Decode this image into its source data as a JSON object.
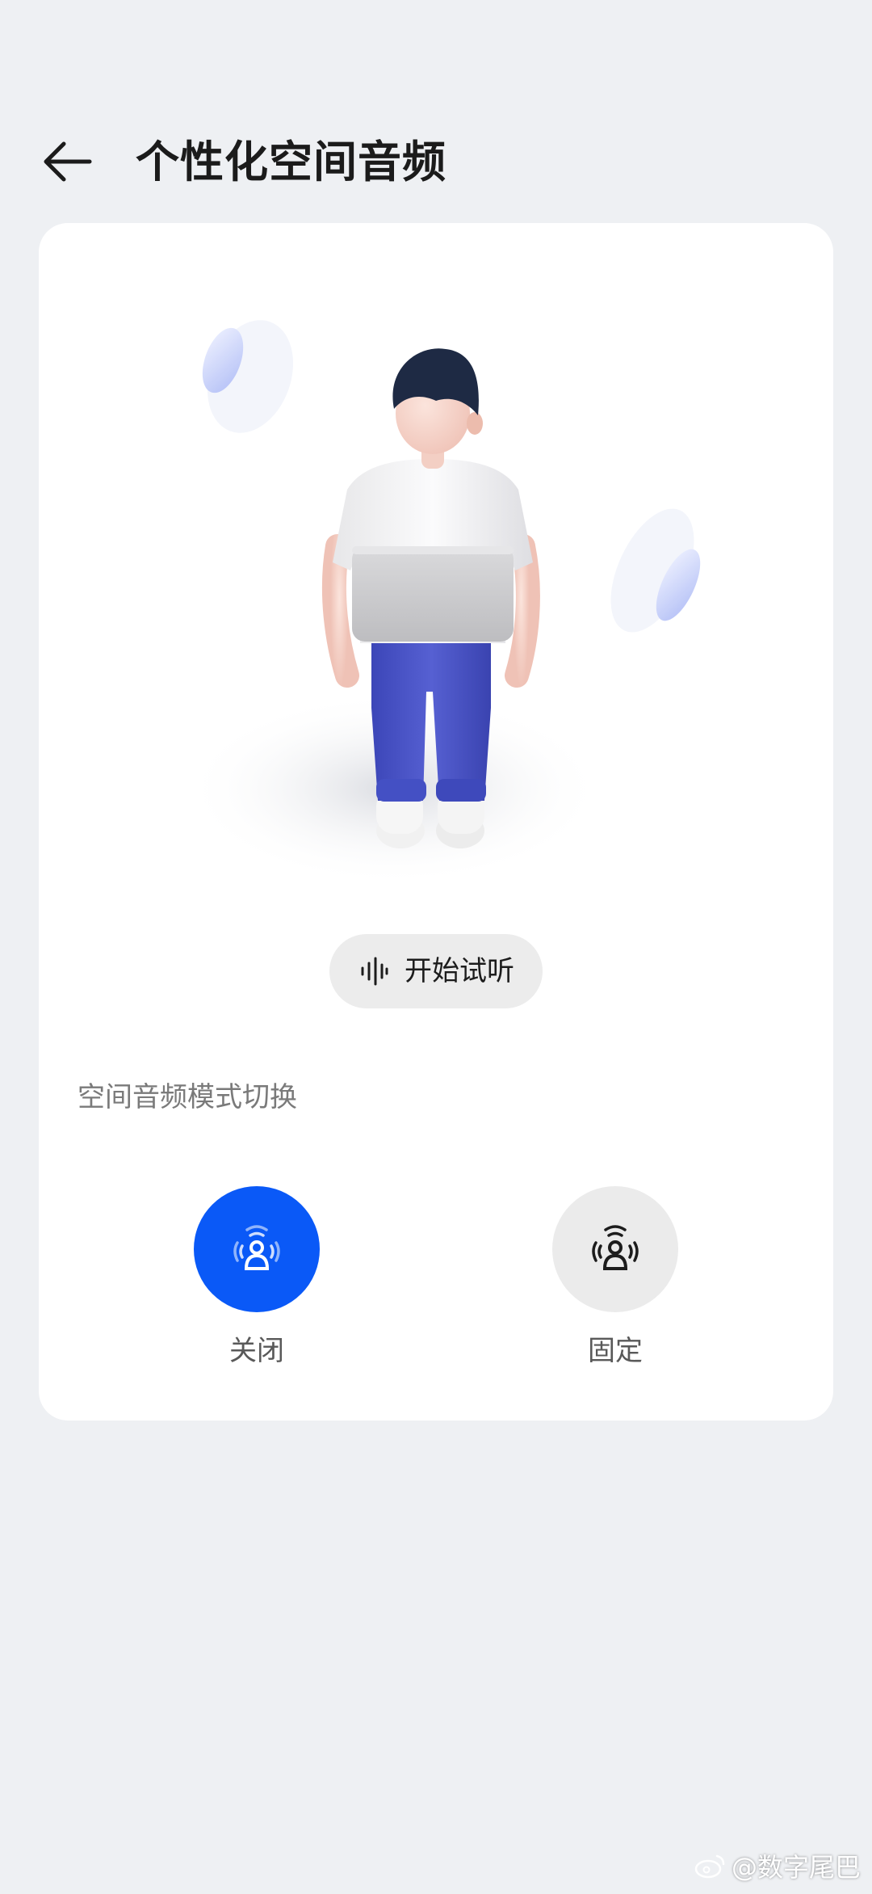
{
  "header": {
    "back_icon": "arrow-left-icon",
    "title": "个性化空间音频"
  },
  "preview": {
    "listen_icon": "sound-wave-icon",
    "listen_label": "开始试听"
  },
  "mode_section": {
    "label": "空间音频模式切换",
    "modes": [
      {
        "label": "关闭",
        "icon": "person-sound-icon",
        "selected": true
      },
      {
        "label": "固定",
        "icon": "person-surround-icon",
        "selected": false
      }
    ]
  },
  "colors": {
    "accent": "#0a59f7",
    "page_background": "#eef0f3",
    "card_background": "#ffffff"
  },
  "watermark": {
    "text": "@数字尾巴"
  }
}
